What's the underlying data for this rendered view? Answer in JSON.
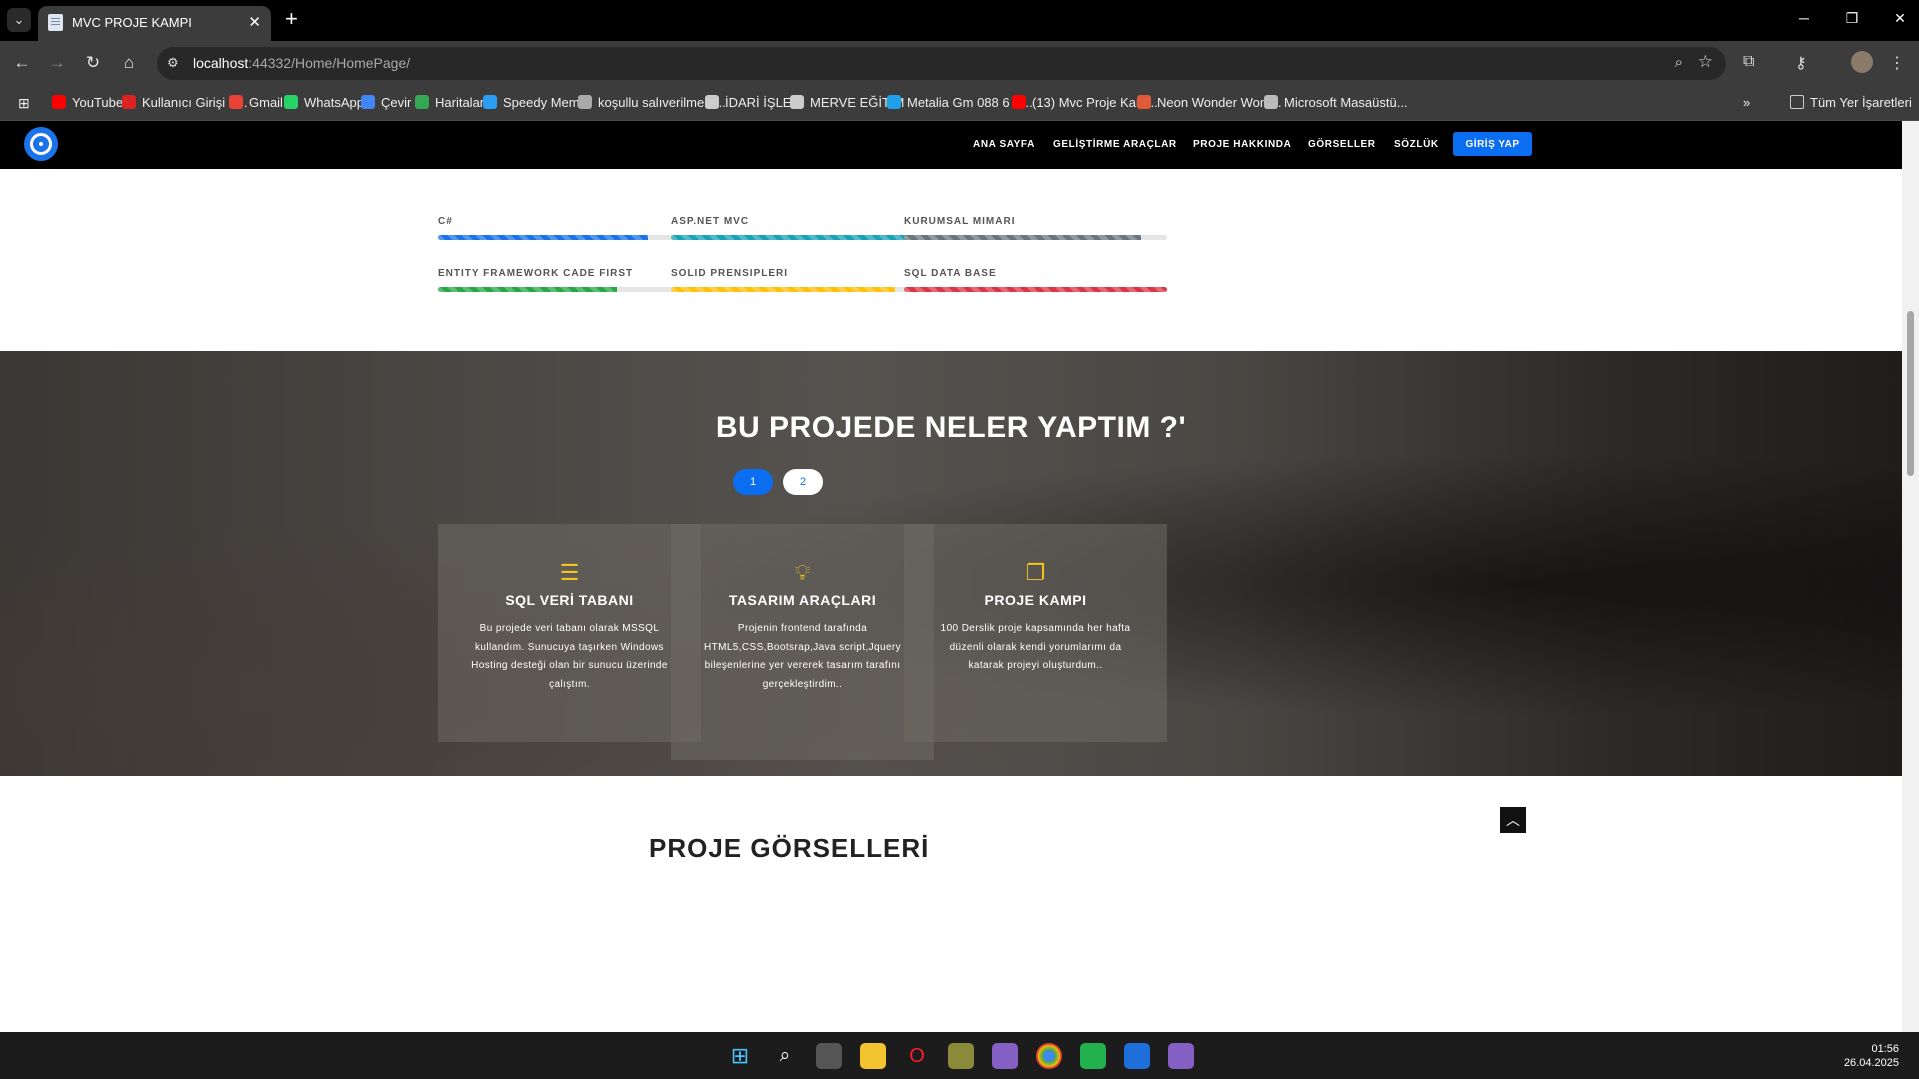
{
  "browser": {
    "tab_title": "MVC PROJE KAMPI",
    "url_host": "localhost",
    "url_rest": ":44332/Home/HomePage/",
    "bookmarks": [
      {
        "label": "YouTube",
        "color": "#ff0000"
      },
      {
        "label": "Kullanıcı Girişi - ...",
        "color": "#d22"
      },
      {
        "label": "Gmail",
        "color": "#ea4335"
      },
      {
        "label": "WhatsApp",
        "color": "#25d366"
      },
      {
        "label": "Çevir",
        "color": "#4285f4"
      },
      {
        "label": "Haritalar",
        "color": "#34a853"
      },
      {
        "label": "Speedy Memo",
        "color": "#2a9df4"
      },
      {
        "label": "koşullu salıverilme o...",
        "color": "#aaaaaa"
      },
      {
        "label": "İDARİ İŞLER",
        "color": "#cccccc"
      },
      {
        "label": "MERVE EĞİTİM",
        "color": "#cccccc"
      },
      {
        "label": "Metalia Gm 088 6 K...",
        "color": "#1ea1e8"
      },
      {
        "label": "(13) Mvc Proje Kam...",
        "color": "#ff0000"
      },
      {
        "label": "Neon Wonder Wom...",
        "color": "#e05a3a"
      },
      {
        "label": "Microsoft Masaüstü...",
        "color": "#bbbbbb"
      }
    ],
    "all_bookmarks_label": "Tüm Yer İşaretleri"
  },
  "site": {
    "nav": [
      "ANA SAYFA",
      "GELİŞTİRME ARAÇLAR",
      "PROJE HAKKINDA",
      "GÖRSELLER",
      "SÖZLÜK"
    ],
    "login_label": "GİRİŞ YAP"
  },
  "skills": [
    {
      "label": "C#",
      "percent": 80,
      "color": "#1a73e8"
    },
    {
      "label": "ASP.NET MVC",
      "percent": 95,
      "color": "#17a2b8"
    },
    {
      "label": "KURUMSAL MIMARI",
      "percent": 90,
      "color": "#6c757d"
    },
    {
      "label": "ENTITY FRAMEWORK CADE FIRST",
      "percent": 68,
      "color": "#28a745"
    },
    {
      "label": "SOLID PRENSIPLERI",
      "percent": 85,
      "color": "#ffc107"
    },
    {
      "label": "SQL DATA BASE",
      "percent": 100,
      "color": "#dc3545"
    }
  ],
  "features": {
    "title": "BU PROJEDE NELER YAPTIM ?'",
    "pages": [
      "1",
      "2"
    ],
    "cards": [
      {
        "icon": "list-icon",
        "title": "SQL VERİ TABANI",
        "text": "Bu projede veri tabanı olarak MSSQL kullandım. Sunucuya taşırken Windows Hosting desteği olan bir sunucu üzerinde çalıştım."
      },
      {
        "icon": "lightbulb-icon",
        "title": "TASARIM ARAÇLARI",
        "text": "Projenin frontend tarafında HTML5,CSS,Bootsrap,Java script,Jquery bileşenlerine yer vererek tasarım tarafını gerçekleştirdim.."
      },
      {
        "icon": "copy-icon",
        "title": "PROJE KAMPI",
        "text": "100 Derslik proje kapsamında her hafta düzenli olarak kendi yorumlarımı da katarak projeyi oluşturdum.."
      }
    ]
  },
  "next_section_title": "PROJE GÖRSELLERİ",
  "clock": {
    "time": "01:56",
    "date": "26.04.2025"
  }
}
